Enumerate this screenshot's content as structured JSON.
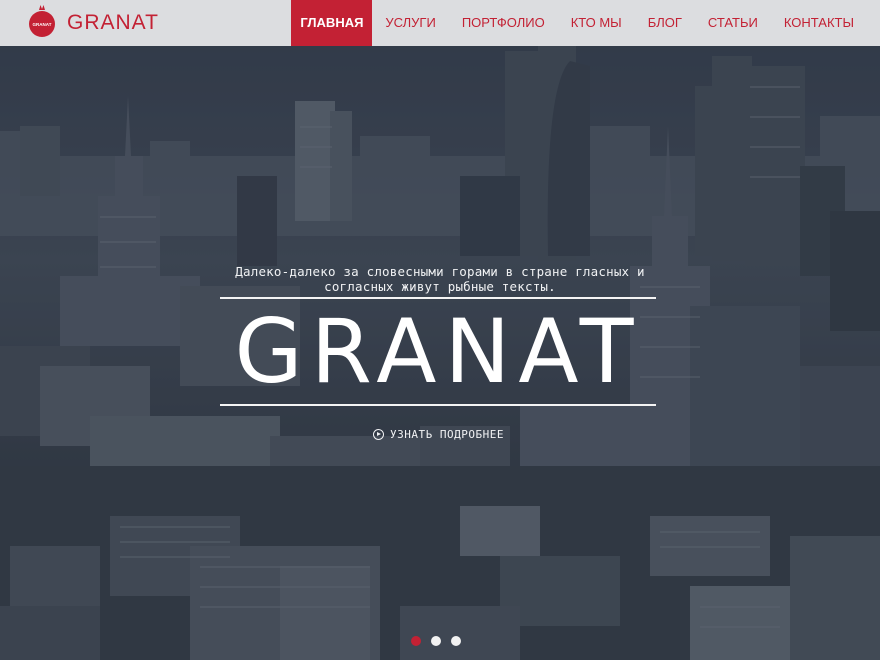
{
  "header": {
    "brand": "GRANAT",
    "logo_text": "GRANAT",
    "accent_color": "#c32134"
  },
  "nav": {
    "items": [
      {
        "label": "ГЛАВНАЯ",
        "active": true
      },
      {
        "label": "УСЛУГИ",
        "active": false
      },
      {
        "label": "ПОРТФОЛИО",
        "active": false
      },
      {
        "label": "КТО МЫ",
        "active": false
      },
      {
        "label": "БЛОГ",
        "active": false
      },
      {
        "label": "СТАТЬИ",
        "active": false
      },
      {
        "label": "КОНТАКТЫ",
        "active": false
      }
    ]
  },
  "hero": {
    "tagline": "Далеко-далеко за словесными горами в стране гласных и согласных живут рыбные тексты.",
    "title": "GRANAT",
    "more_label": "УЗНАТЬ ПОДРОБНЕЕ",
    "more_icon": "play-circle-icon",
    "slides": [
      {
        "active": true
      },
      {
        "active": false
      },
      {
        "active": false
      }
    ]
  }
}
